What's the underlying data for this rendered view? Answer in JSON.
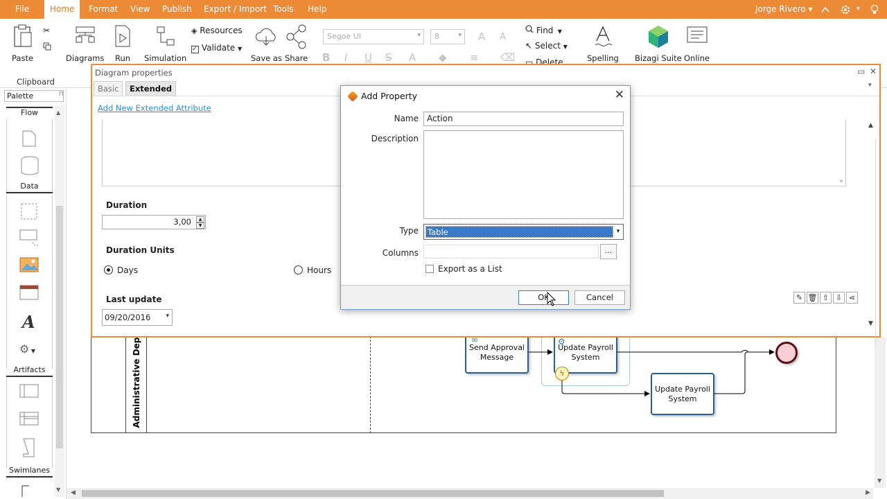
{
  "menubar": {
    "tabs": [
      "File",
      "Home",
      "Format",
      "View",
      "Publish",
      "Export / Import",
      "Tools",
      "Help"
    ],
    "active_tab": "Home",
    "user": "Jorge Rivero ▾"
  },
  "ribbon": {
    "paste": "Paste",
    "clipboard": "Clipboard",
    "diagrams": "Diagrams",
    "run": "Run",
    "simulation": "Simulation",
    "resources": "Resources",
    "validate": "Validate",
    "save_as": "Save as",
    "share": "Share",
    "font_name": "Segoe UI",
    "font_size": "8",
    "find": "Find",
    "select": "Select",
    "delete": "Delete",
    "spelling": "Spelling",
    "bizagi_suite": "Bizagi Suite",
    "online": "Online"
  },
  "palette": {
    "title": "Palette",
    "sections": [
      "Flow",
      "Data",
      "Artifacts",
      "Swimlanes"
    ]
  },
  "properties": {
    "title": "Diagram properties",
    "tabs": [
      "Basic",
      "Extended"
    ],
    "active_tab": "Extended",
    "add_link": "Add New Extended Attribute",
    "duration_label": "Duration",
    "duration_value": "3,00",
    "duration_units_label": "Duration Units",
    "units": [
      "Days",
      "Hours"
    ],
    "selected_unit": "Days",
    "last_update_label": "Last update",
    "last_update_value": "09/20/2016"
  },
  "dialog": {
    "title": "Add Property",
    "name_label": "Name",
    "name_value": "Action",
    "description_label": "Description",
    "description_value": "",
    "type_label": "Type",
    "type_value": "Table",
    "columns_label": "Columns",
    "columns_button": "...",
    "export_list_label": "Export as a List",
    "export_list_checked": false,
    "ok": "OK",
    "cancel": "Cancel"
  },
  "diagram": {
    "lane_title": "Administrative Depa",
    "tasks": [
      "Send Approval Message",
      "Update Payroll System",
      "Update Payroll System"
    ]
  },
  "colors": {
    "accent": "#ed8a35",
    "task_border": "#2a5f8a",
    "end_event": "#5b1018",
    "selection": "#3a78c8",
    "link": "#2c8ed8"
  }
}
